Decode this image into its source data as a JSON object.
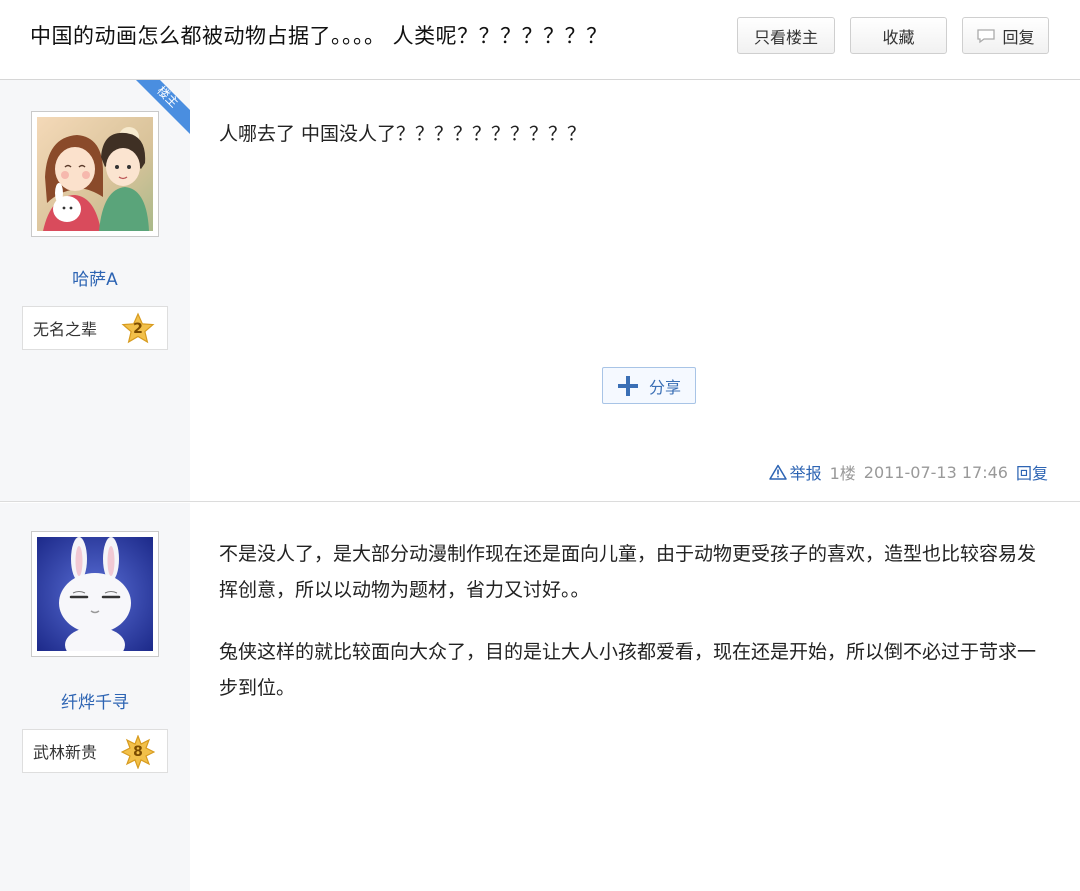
{
  "header": {
    "title": "中国的动画怎么都被动物占据了。。。。 人类呢？？？？？？？",
    "only_op_label": "只看楼主",
    "collect_label": "收藏",
    "reply_label": "回复"
  },
  "posts": [
    {
      "op_tag": "楼主",
      "username": "哈萨A",
      "rank_name": "无名之辈",
      "rank_level": "2",
      "paragraphs": [
        "人哪去了 中国没人了？？？？？？？？？？"
      ],
      "share_label": "分享",
      "report_label": "举报",
      "floor": "1楼",
      "timestamp": "2011-07-13 17:46",
      "reply_label": "回复"
    },
    {
      "username": "纤烨千寻",
      "rank_name": "武林新贵",
      "rank_level": "8",
      "paragraphs": [
        "不是没人了，是大部分动漫制作现在还是面向儿童，由于动物更受孩子的喜欢，造型也比较容易发挥创意，所以以动物为题材，省力又讨好。。",
        "兔侠这样的就比较面向大众了，目的是让大人小孩都爱看，现在还是开始，所以倒不必过于苛求一步到位。"
      ]
    }
  ],
  "colors": {
    "link": "#2d64b3",
    "ribbon": "#4a8ee0",
    "sidebar_bg": "#f6f7f9",
    "badge_gold": "#f2c04a"
  },
  "icons": [
    "reply-bubble-icon",
    "share-plus-icon",
    "warning-icon",
    "star-badge-icon",
    "avatar-couple",
    "avatar-rabbit"
  ]
}
